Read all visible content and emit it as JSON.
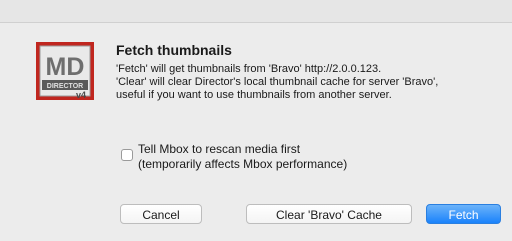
{
  "dialog": {
    "title": "Fetch thumbnails",
    "message_lines": [
      "'Fetch' will get thumbnails from 'Bravo' http://2.0.0.123.",
      "'Clear' will clear Director's local thumbnail cache for server 'Bravo',",
      "useful if you want to use thumbnails from another server."
    ],
    "app_icon": {
      "name": "director-app-icon",
      "logo_text": "MD",
      "subtitle": "DIRECTOR",
      "badge": "v4"
    }
  },
  "checkbox": {
    "checked": false,
    "label_lines": [
      "Tell Mbox to rescan media first",
      "(temporarily affects Mbox performance)"
    ]
  },
  "buttons": {
    "cancel": "Cancel",
    "clear_cache": "Clear 'Bravo' Cache",
    "fetch": "Fetch"
  },
  "colors": {
    "dialog_background": "#ececec",
    "default_button": "#1a82fb"
  }
}
